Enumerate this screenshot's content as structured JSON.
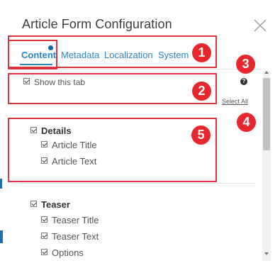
{
  "dialog": {
    "title": "Article Form Configuration",
    "close_icon": "close-icon"
  },
  "tabs": [
    {
      "label": "Content",
      "active": true,
      "has_indicator": true
    },
    {
      "label": "Metadata",
      "active": false
    },
    {
      "label": "Localization",
      "active": false
    },
    {
      "label": "System",
      "active": false
    }
  ],
  "content": {
    "show_tab": {
      "label": "Show this tab",
      "checked": true
    },
    "help_icon": "help-icon",
    "help_glyph": "?",
    "select_all": "Select All",
    "groups": [
      {
        "label": "Details",
        "checked": true,
        "items": [
          {
            "label": "Article Title",
            "checked": true
          },
          {
            "label": "Article Text",
            "checked": true
          }
        ]
      },
      {
        "label": "Teaser",
        "checked": true,
        "items": [
          {
            "label": "Teaser Title",
            "checked": true
          },
          {
            "label": "Teaser Text",
            "checked": true
          },
          {
            "label": "Options",
            "checked": true
          }
        ]
      }
    ]
  },
  "annotations": [
    "1",
    "2",
    "3",
    "4",
    "5"
  ],
  "colors": {
    "accent": "#2a86c9",
    "annotation_red": "#e8262d",
    "annotation_border": "#d9363e"
  }
}
